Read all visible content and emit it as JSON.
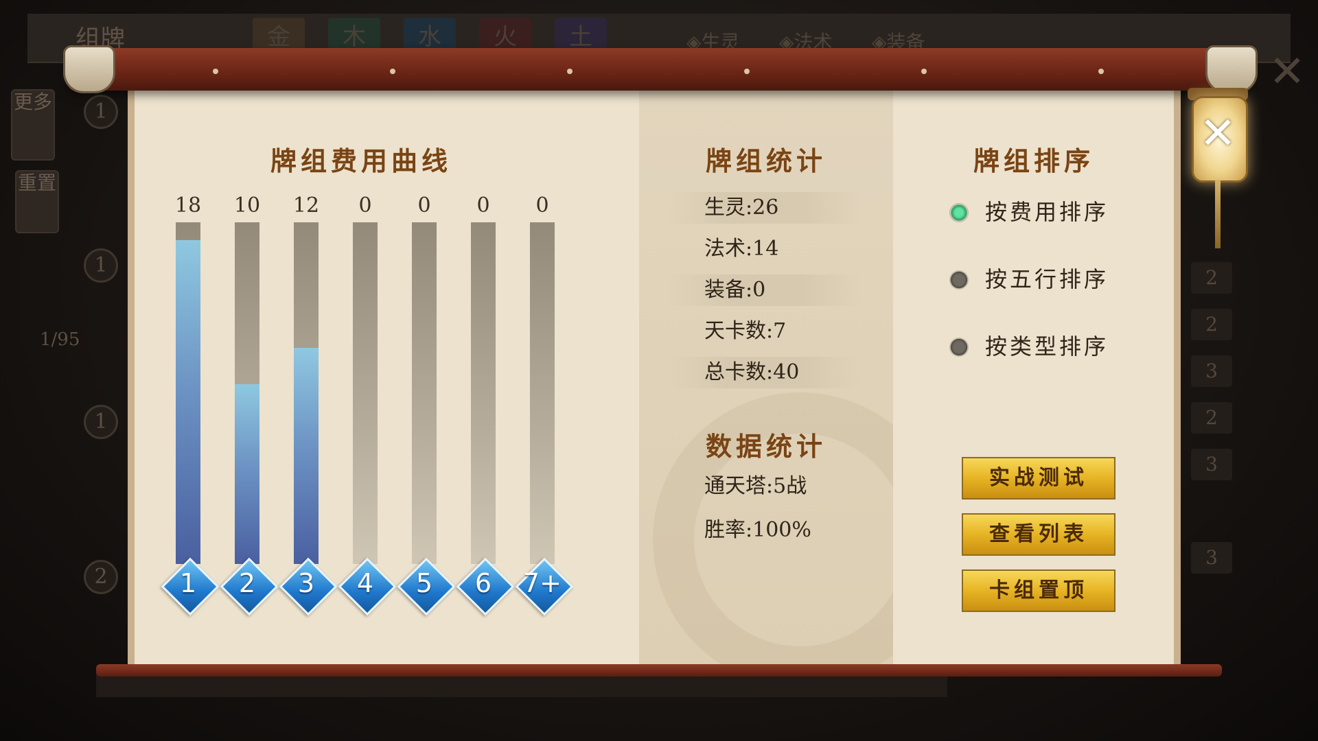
{
  "background": {
    "title": "组牌",
    "elements": [
      "金",
      "木",
      "水",
      "火",
      "土"
    ],
    "types": [
      "◈生灵",
      "◈法术",
      "◈装备"
    ],
    "side_buttons": [
      "更多",
      "重置"
    ],
    "page": "1/95",
    "coins": [
      "1",
      "1",
      "1",
      "2"
    ],
    "right_counts": [
      "2",
      "2",
      "3",
      "2",
      "3",
      "3"
    ]
  },
  "cost_curve": {
    "title": "牌组费用曲线"
  },
  "chart_data": {
    "type": "bar",
    "categories": [
      "1",
      "2",
      "3",
      "4",
      "5",
      "6",
      "7+"
    ],
    "values": [
      18,
      10,
      12,
      0,
      0,
      0,
      0
    ],
    "title": "牌组费用曲线",
    "ylim": [
      0,
      19
    ]
  },
  "deck_stats": {
    "title": "牌组统计",
    "rows": [
      "生灵:26",
      "法术:14",
      "装备:0",
      "天卡数:7",
      "总卡数:40"
    ]
  },
  "data_stats": {
    "title": "数据统计",
    "rows": [
      "通天塔:5战",
      "胜率:100%"
    ]
  },
  "deck_sort": {
    "title": "牌组排序",
    "options": [
      {
        "label": "按费用排序",
        "selected": true
      },
      {
        "label": "按五行排序",
        "selected": false
      },
      {
        "label": "按类型排序",
        "selected": false
      }
    ]
  },
  "buttons": {
    "battle_test": "实战测试",
    "view_list": "查看列表",
    "pin_deck": "卡组置顶"
  },
  "close_symbol": "✕"
}
